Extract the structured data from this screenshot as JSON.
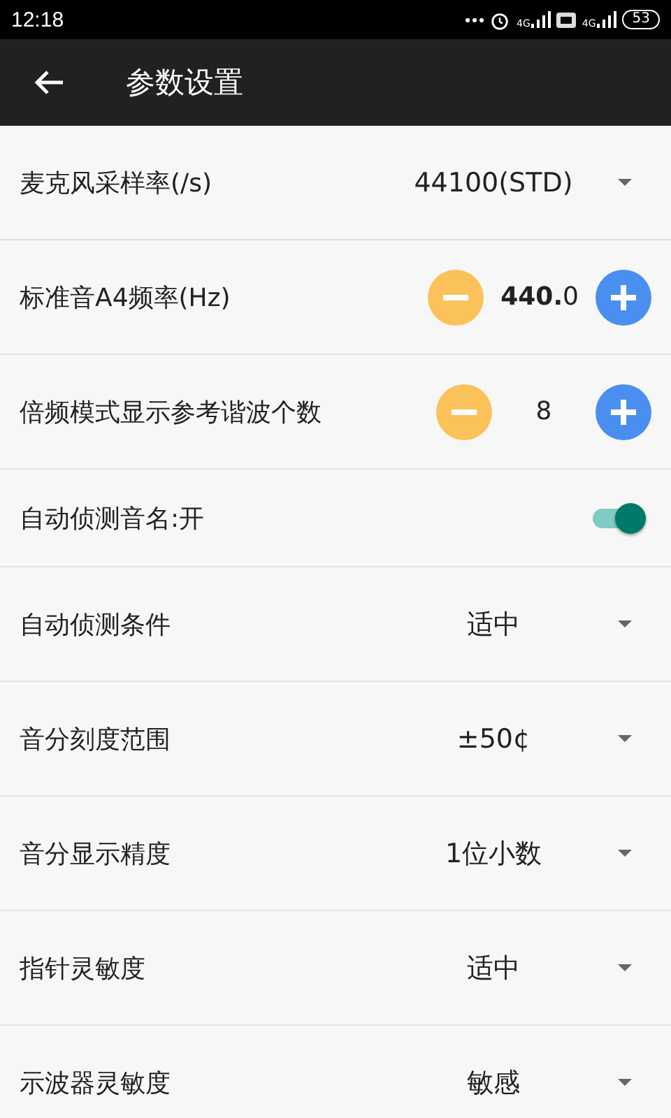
{
  "status_bar": {
    "time": "12:18",
    "network_1": "4G",
    "network_2": "4G",
    "battery": "53"
  },
  "app_bar": {
    "title": "参数设置"
  },
  "settings": [
    {
      "kind": "dropdown",
      "label": "麦克风采样率(/s)",
      "value": "44100(STD)"
    },
    {
      "kind": "stepper",
      "label": "标准音A4频率(Hz)",
      "value": "**440.**0"
    },
    {
      "kind": "stepper",
      "label": "倍频模式显示参考谐波个数",
      "value": "8"
    },
    {
      "kind": "toggle",
      "label": "自动侦测音名:开",
      "on": true
    },
    {
      "kind": "dropdown",
      "label": "自动侦测条件",
      "value": "适中"
    },
    {
      "kind": "dropdown",
      "label": "音分刻度范围",
      "value": "±50¢"
    },
    {
      "kind": "dropdown",
      "label": "音分显示精度",
      "value": "1位小数"
    },
    {
      "kind": "dropdown",
      "label": "指针灵敏度",
      "value": "适中"
    },
    {
      "kind": "dropdown",
      "label": "示波器灵敏度",
      "value": "敏感"
    }
  ]
}
